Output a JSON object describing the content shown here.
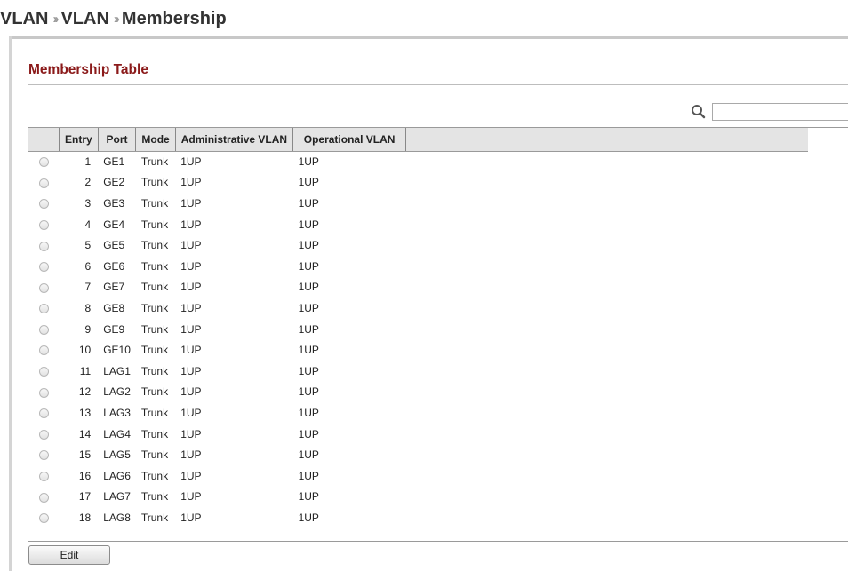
{
  "breadcrumb": {
    "items": [
      "VLAN",
      "VLAN",
      "Membership"
    ],
    "separator": "››"
  },
  "section": {
    "title": "Membership Table"
  },
  "search": {
    "value": "",
    "placeholder": ""
  },
  "table": {
    "columns": [
      "Entry",
      "Port",
      "Mode",
      "Administrative VLAN",
      "Operational VLAN"
    ],
    "rows": [
      {
        "entry": "1",
        "port": "GE1",
        "mode": "Trunk",
        "admin_vlan": "1UP",
        "oper_vlan": "1UP"
      },
      {
        "entry": "2",
        "port": "GE2",
        "mode": "Trunk",
        "admin_vlan": "1UP",
        "oper_vlan": "1UP"
      },
      {
        "entry": "3",
        "port": "GE3",
        "mode": "Trunk",
        "admin_vlan": "1UP",
        "oper_vlan": "1UP"
      },
      {
        "entry": "4",
        "port": "GE4",
        "mode": "Trunk",
        "admin_vlan": "1UP",
        "oper_vlan": "1UP"
      },
      {
        "entry": "5",
        "port": "GE5",
        "mode": "Trunk",
        "admin_vlan": "1UP",
        "oper_vlan": "1UP"
      },
      {
        "entry": "6",
        "port": "GE6",
        "mode": "Trunk",
        "admin_vlan": "1UP",
        "oper_vlan": "1UP"
      },
      {
        "entry": "7",
        "port": "GE7",
        "mode": "Trunk",
        "admin_vlan": "1UP",
        "oper_vlan": "1UP"
      },
      {
        "entry": "8",
        "port": "GE8",
        "mode": "Trunk",
        "admin_vlan": "1UP",
        "oper_vlan": "1UP"
      },
      {
        "entry": "9",
        "port": "GE9",
        "mode": "Trunk",
        "admin_vlan": "1UP",
        "oper_vlan": "1UP"
      },
      {
        "entry": "10",
        "port": "GE10",
        "mode": "Trunk",
        "admin_vlan": "1UP",
        "oper_vlan": "1UP"
      },
      {
        "entry": "11",
        "port": "LAG1",
        "mode": "Trunk",
        "admin_vlan": "1UP",
        "oper_vlan": "1UP"
      },
      {
        "entry": "12",
        "port": "LAG2",
        "mode": "Trunk",
        "admin_vlan": "1UP",
        "oper_vlan": "1UP"
      },
      {
        "entry": "13",
        "port": "LAG3",
        "mode": "Trunk",
        "admin_vlan": "1UP",
        "oper_vlan": "1UP"
      },
      {
        "entry": "14",
        "port": "LAG4",
        "mode": "Trunk",
        "admin_vlan": "1UP",
        "oper_vlan": "1UP"
      },
      {
        "entry": "15",
        "port": "LAG5",
        "mode": "Trunk",
        "admin_vlan": "1UP",
        "oper_vlan": "1UP"
      },
      {
        "entry": "16",
        "port": "LAG6",
        "mode": "Trunk",
        "admin_vlan": "1UP",
        "oper_vlan": "1UP"
      },
      {
        "entry": "17",
        "port": "LAG7",
        "mode": "Trunk",
        "admin_vlan": "1UP",
        "oper_vlan": "1UP"
      },
      {
        "entry": "18",
        "port": "LAG8",
        "mode": "Trunk",
        "admin_vlan": "1UP",
        "oper_vlan": "1UP"
      }
    ]
  },
  "actions": {
    "edit_label": "Edit"
  },
  "icons": {
    "search": "search-icon",
    "row_select": "radio-button"
  },
  "colors": {
    "section_title": "#8b1a1a",
    "header_bg": "#e4e4e4",
    "border": "#9a9a9a"
  }
}
